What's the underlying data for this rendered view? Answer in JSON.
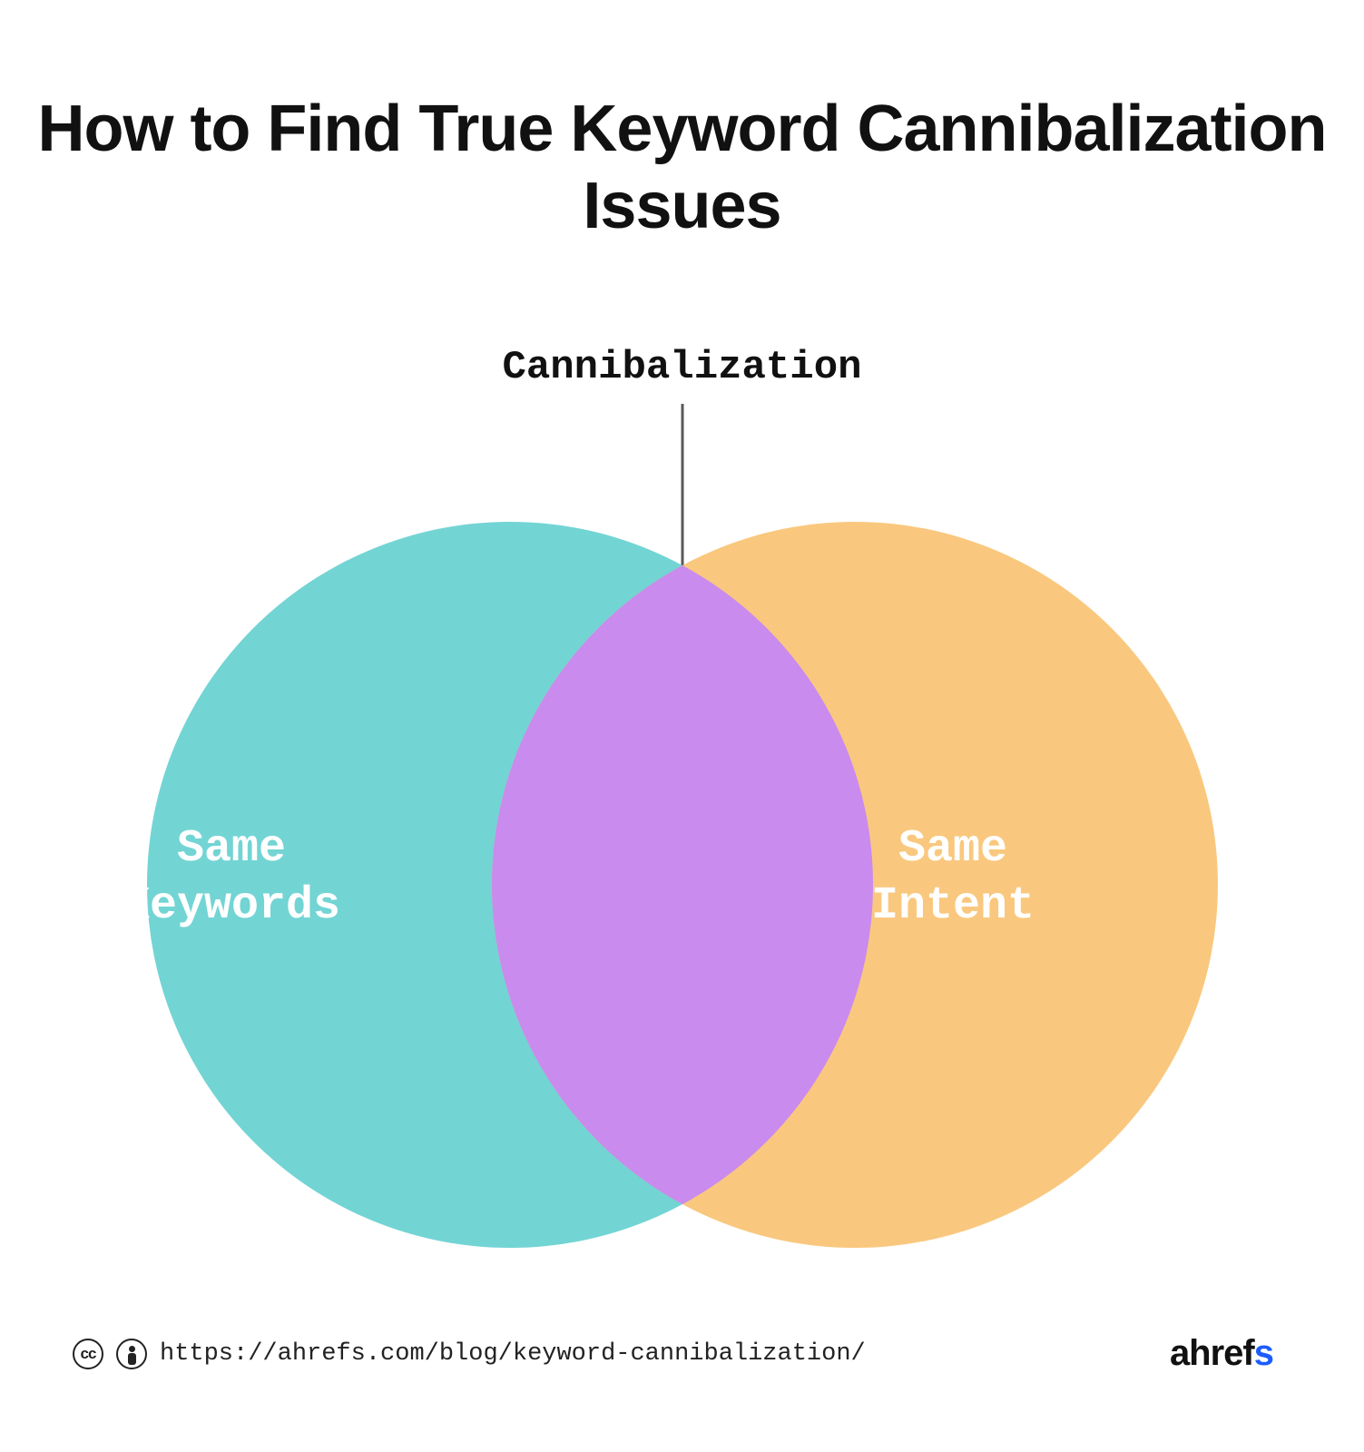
{
  "title": "How to Find True Keyword Cannibalization Issues",
  "diagram": {
    "overlap_label": "Cannibalization",
    "left_circle": {
      "label": "Same\nKeywords",
      "color": "#73d4d4"
    },
    "right_circle": {
      "label": "Same\nIntent",
      "color": "#f9c87e"
    },
    "overlap_color": "#c98bed",
    "arrow_color": "#5a5a5a"
  },
  "footer": {
    "cc_text": "cc",
    "url": "https://ahrefs.com/blog/keyword-cannibalization/",
    "brand_part1": "ahref",
    "brand_part2": "s"
  },
  "chart_data": {
    "type": "venn",
    "sets": [
      {
        "name": "Same Keywords",
        "color": "#73d4d4"
      },
      {
        "name": "Same Intent",
        "color": "#f9c87e"
      }
    ],
    "intersections": [
      {
        "sets": [
          "Same Keywords",
          "Same Intent"
        ],
        "label": "Cannibalization",
        "color": "#c98bed"
      }
    ],
    "title": "How to Find True Keyword Cannibalization Issues"
  }
}
